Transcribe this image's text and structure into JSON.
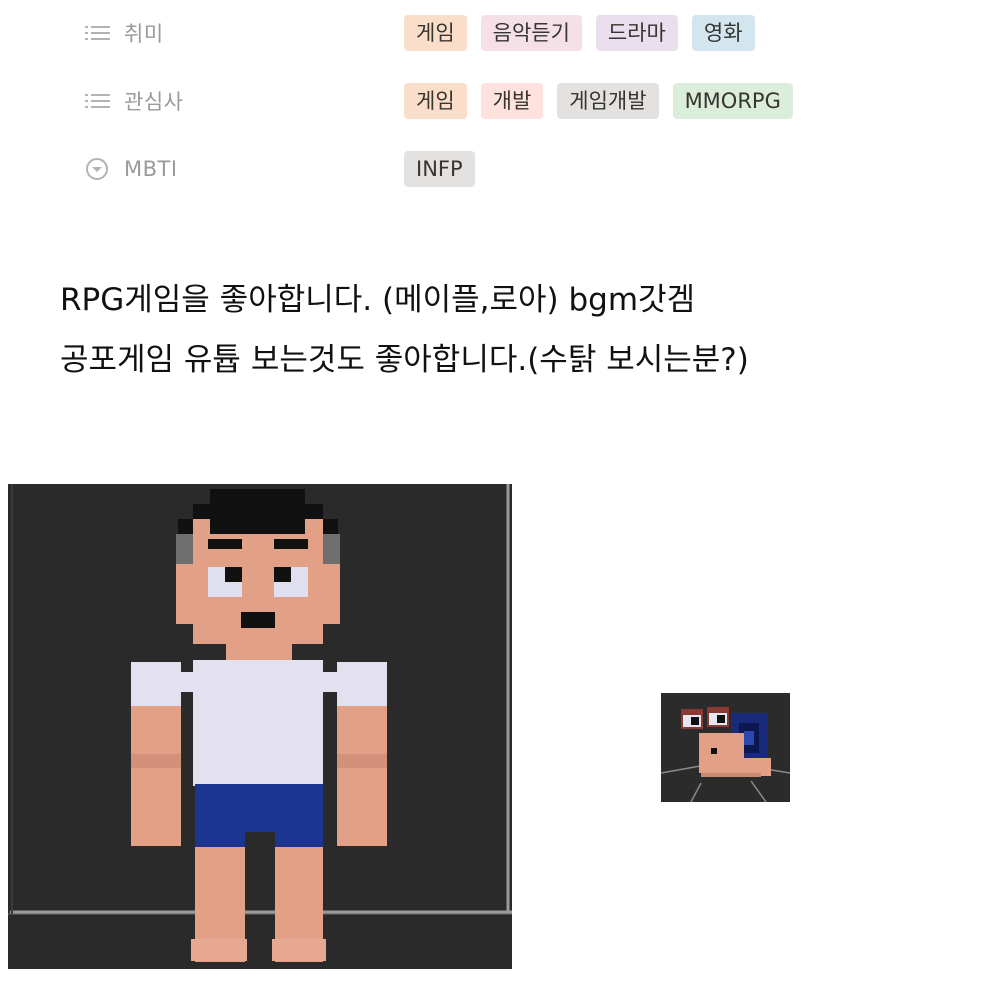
{
  "properties": [
    {
      "label": "취미",
      "icon": "list-icon",
      "tags": [
        {
          "text": "게임",
          "color": "#fadec9"
        },
        {
          "text": "음악듣기",
          "color": "#f5e0e9"
        },
        {
          "text": "드라마",
          "color": "#e8deee"
        },
        {
          "text": "영화",
          "color": "#d3e5ef"
        }
      ]
    },
    {
      "label": "관심사",
      "icon": "list-icon",
      "tags": [
        {
          "text": "게임",
          "color": "#fadec9"
        },
        {
          "text": "개발",
          "color": "#ffe2dd"
        },
        {
          "text": "게임개발",
          "color": "#e3e2e0"
        },
        {
          "text": "MMORPG",
          "color": "#dbeddb"
        }
      ]
    },
    {
      "label": "MBTI",
      "icon": "select-circle-chevron-icon",
      "tags": [
        {
          "text": "INFP",
          "color": "#e3e2e0"
        }
      ]
    }
  ],
  "description": {
    "line1": "RPG게임을 좋아합니다. (메이플,로아) bgm갓겜",
    "line2": "공포게임 유튭 보는것도 좋아합니다.(수탉 보시는분?)"
  },
  "images": {
    "character": "voxel-character-boy",
    "snail": "voxel-snail"
  }
}
